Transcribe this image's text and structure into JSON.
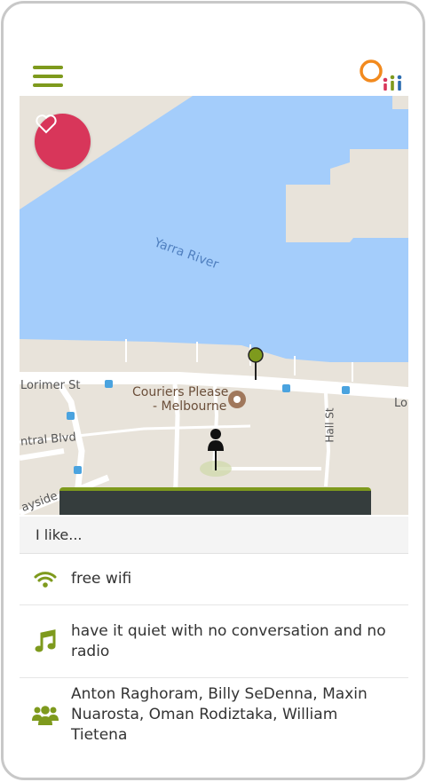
{
  "header": {
    "menu_icon": "hamburger-menu-icon",
    "logo_icon": "oiii-logo",
    "accent_color": "#7e9a1d"
  },
  "map": {
    "labels": {
      "river": "Yarra River",
      "lorimer_left": "Lorimer St",
      "lorimer_right": "Lo",
      "business_line1": "Couriers Please",
      "business_line2": "- Melbourne",
      "hall": "Hall St",
      "central": "ntral Blvd",
      "bayside": "ayside A"
    },
    "favorite_icon": "heart-icon",
    "favorite_color": "#d8365a"
  },
  "preferences": {
    "heading": "I like...",
    "items": [
      {
        "icon": "wifi-icon",
        "label": "free wifi"
      },
      {
        "icon": "music-note-icon",
        "label": "have it quiet with no conversation and no radio"
      },
      {
        "icon": "group-icon",
        "label": "Anton Raghoram, Billy SeDenna, Maxin Nuarosta, Oman Rodiztaka, William Tietena"
      }
    ]
  }
}
